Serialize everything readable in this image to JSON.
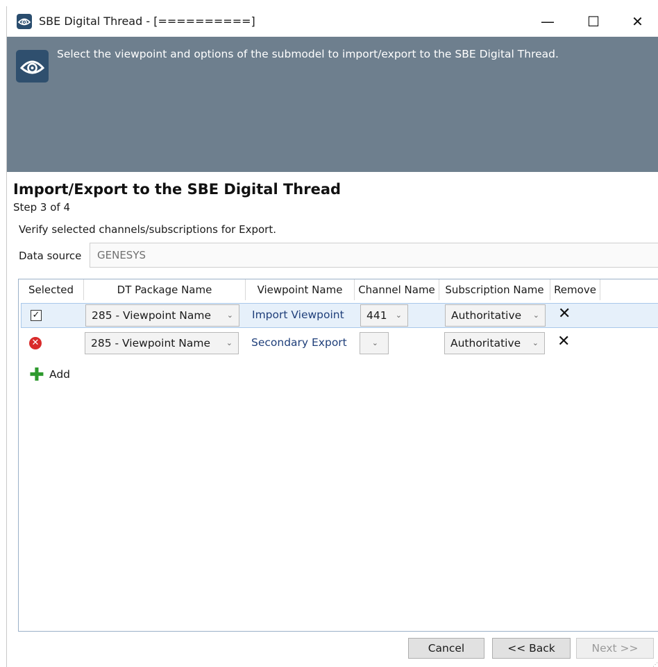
{
  "window": {
    "title": "SBE Digital Thread - [==========]",
    "minimize_glyph": "—",
    "maximize_glyph": "☐",
    "close_glyph": "✕"
  },
  "banner": {
    "text": "Select the viewpoint and options of the submodel to import/export to the SBE Digital Thread.",
    "color": "#6e7f8e"
  },
  "page": {
    "heading": "Import/Export to the SBE Digital Thread",
    "step": "Step 3 of 4",
    "instruction": "Verify selected channels/subscriptions for Export."
  },
  "data_source": {
    "label": "Data source",
    "value": "GENESYS"
  },
  "grid": {
    "columns": [
      "Selected",
      "DT Package Name",
      "Viewpoint Name",
      "Channel Name",
      "Subscription Name",
      "Remove"
    ],
    "rows": [
      {
        "selected_state": "checked",
        "selected_glyph": "✓",
        "dt_package": "285 - Viewpoint Name",
        "viewpoint": "Import Viewpoint",
        "channel": "441",
        "subscription": "Authoritative",
        "remove_glyph": "✕"
      },
      {
        "selected_state": "error",
        "selected_glyph": "✕",
        "dt_package": "285 - Viewpoint Name",
        "viewpoint": "Secondary Export",
        "channel": "",
        "subscription": "Authoritative",
        "remove_glyph": "✕"
      }
    ],
    "dropdown_glyph": "⌄",
    "add_glyph": "✚",
    "add_label": "Add"
  },
  "footer": {
    "cancel_label": "Cancel",
    "back_label": "<< Back",
    "next_label": "Next >>",
    "next_enabled": false
  },
  "icons": {
    "app": "eye-logo-icon",
    "banner": "eye-logo-icon",
    "checkbox": "checkbox-checked-icon",
    "error": "error-circle-icon",
    "remove": "close-x-icon",
    "add": "plus-icon"
  }
}
